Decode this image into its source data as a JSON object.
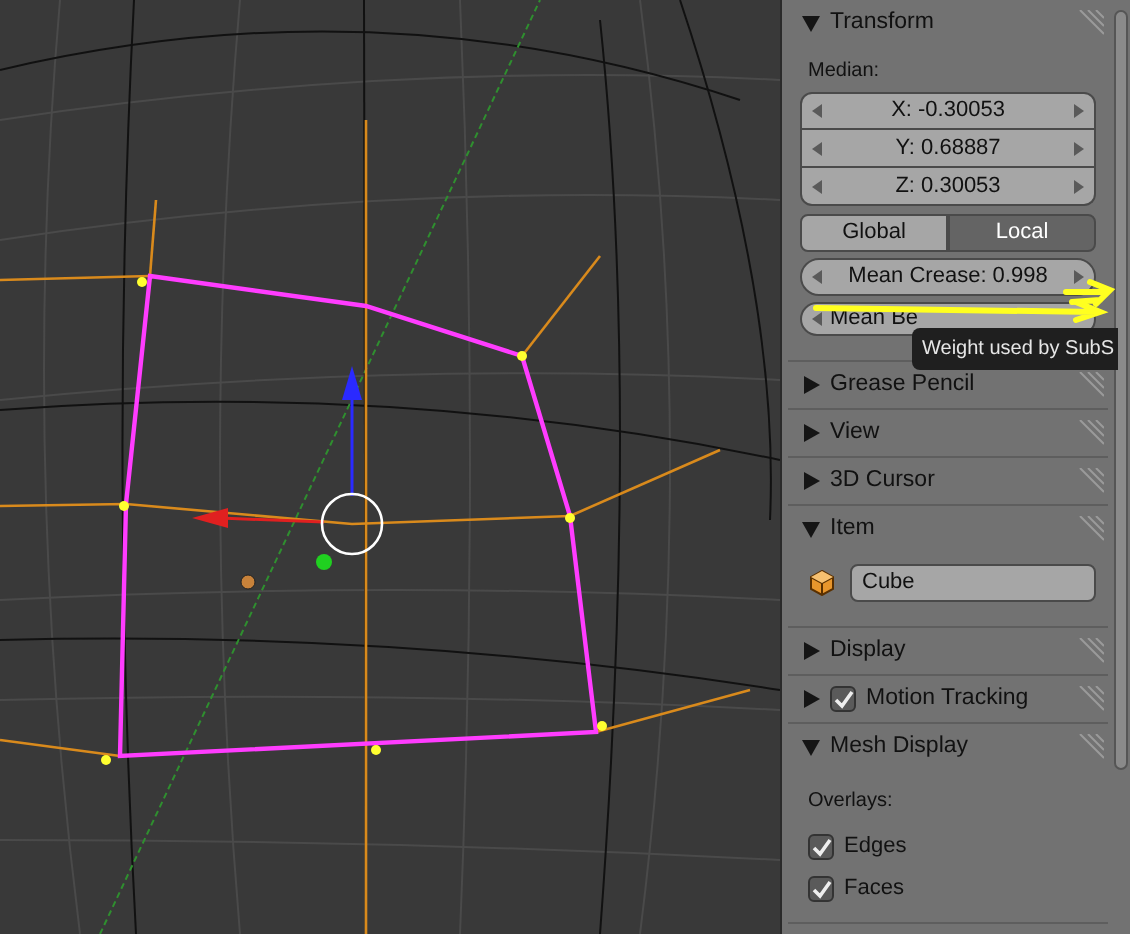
{
  "sidebar": {
    "panels": [
      {
        "kind": "transform",
        "title": "Transform",
        "expanded": true,
        "median_label": "Median:",
        "fields": [
          "X: -0.30053",
          "Y: 0.68887",
          "Z: 0.30053"
        ],
        "space_toggle": [
          {
            "label": "Global",
            "selected": false
          },
          {
            "label": "Local",
            "selected": true
          }
        ],
        "crease_field": "Mean Crease: 0.998",
        "bevel_field": "Mean Be"
      },
      {
        "kind": "plain",
        "title": "Grease Pencil",
        "expanded": false
      },
      {
        "kind": "plain",
        "title": "View",
        "expanded": false
      },
      {
        "kind": "plain",
        "title": "3D Cursor",
        "expanded": false
      },
      {
        "kind": "item",
        "title": "Item",
        "expanded": true,
        "name_value": "Cube"
      },
      {
        "kind": "plain",
        "title": "Display",
        "expanded": false
      },
      {
        "kind": "checkbox",
        "title": "Motion Tracking",
        "expanded": false,
        "checked": true
      },
      {
        "kind": "mesh_display",
        "title": "Mesh Display",
        "expanded": true,
        "overlays_label": "Overlays:",
        "options": [
          {
            "label": "Edges",
            "checked": true
          },
          {
            "label": "Faces",
            "checked": true
          }
        ]
      }
    ]
  },
  "tooltip": {
    "text": "Weight used by SubS"
  }
}
